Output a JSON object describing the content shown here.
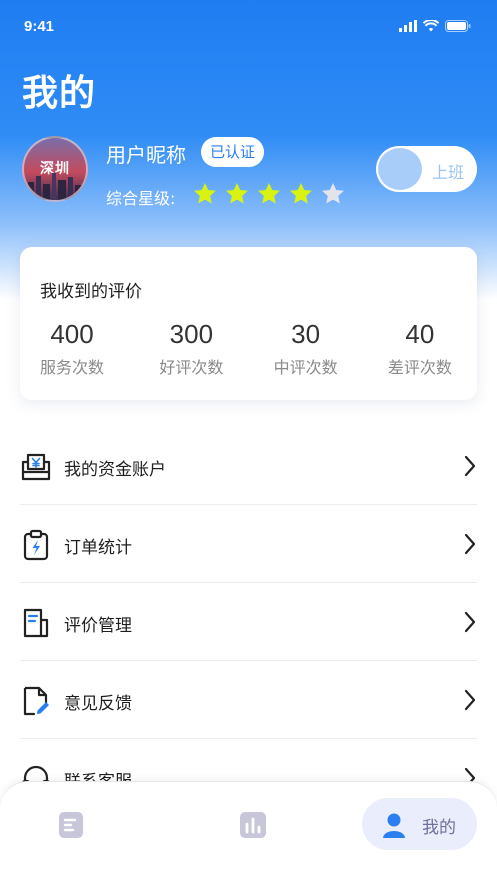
{
  "status_bar": {
    "time": "9:41"
  },
  "page": {
    "title": "我的"
  },
  "profile": {
    "avatar_city": "深圳",
    "nickname": "用户昵称",
    "verified_badge": "已认证",
    "rating_label": "综合星级:",
    "rating": 4,
    "rating_max": 5,
    "star_active_color": "#d8f212",
    "star_inactive_color": "#e2e4ea"
  },
  "duty_toggle": {
    "label": "上班",
    "on": false
  },
  "reviews": {
    "title": "我收到的评价",
    "stats": [
      {
        "value": "400",
        "label": "服务次数"
      },
      {
        "value": "300",
        "label": "好评次数"
      },
      {
        "value": "30",
        "label": "中评次数"
      },
      {
        "value": "40",
        "label": "差评次数"
      }
    ]
  },
  "menu": [
    {
      "label": "我的资金账户",
      "icon": "wallet-yuan-icon"
    },
    {
      "label": "订单统计",
      "icon": "clipboard-bolt-icon"
    },
    {
      "label": "评价管理",
      "icon": "document-list-icon"
    },
    {
      "label": "意见反馈",
      "icon": "file-edit-icon"
    },
    {
      "label": "联系客服",
      "icon": "headset-icon"
    }
  ],
  "tab_bar": {
    "tabs": [
      {
        "id": "orders",
        "icon": "list-icon"
      },
      {
        "id": "stats",
        "icon": "bar-chart-icon"
      },
      {
        "id": "mine",
        "icon": "user-icon",
        "label": "我的",
        "active": true
      }
    ]
  },
  "colors": {
    "primary": "#1f7df2",
    "accent_inactive_tab": "#c7c7d9"
  }
}
